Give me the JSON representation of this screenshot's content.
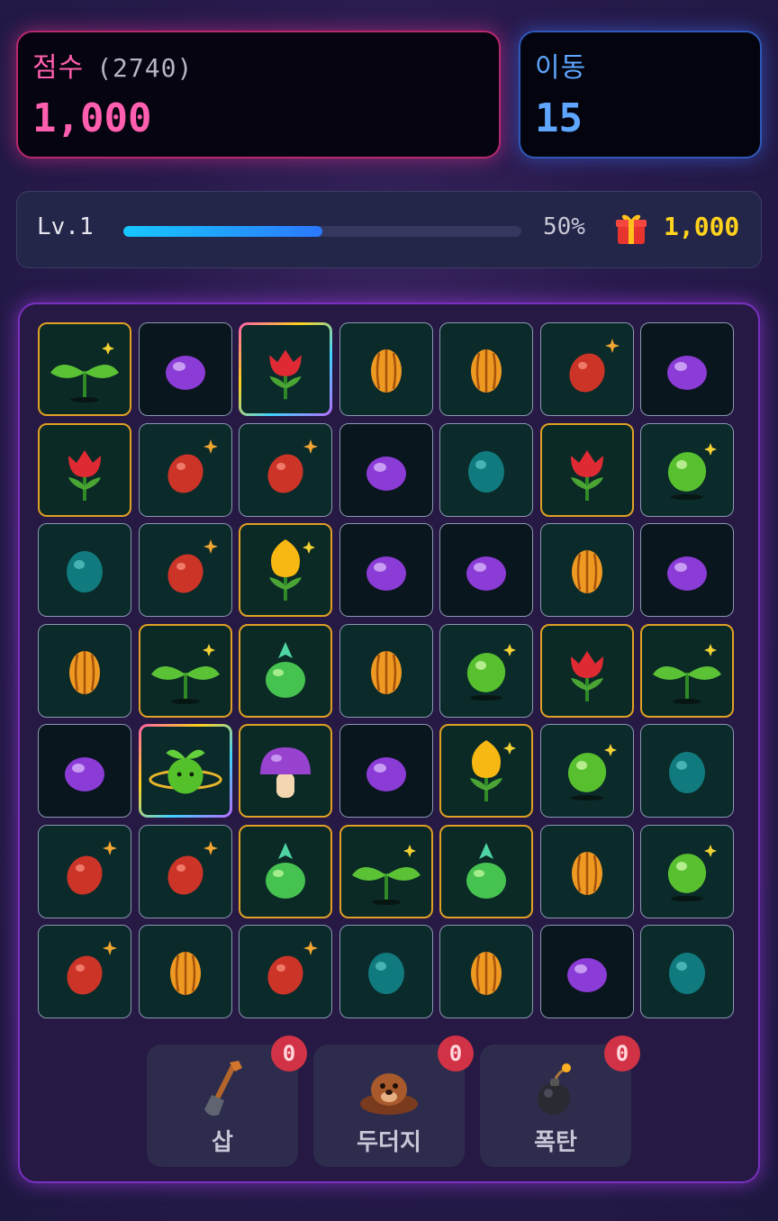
{
  "score": {
    "label": "점수",
    "best": "(2740)",
    "value": "1,000"
  },
  "moves": {
    "label": "이동",
    "value": "15"
  },
  "level": {
    "label": "Lv.1",
    "progress": 0.5,
    "percent_text": "50%",
    "reward": "1,000",
    "reward_icon": "gift-icon"
  },
  "board": {
    "rows": 7,
    "cols": 7,
    "tiles": [
      [
        "sprout",
        "purple",
        "tulip-red",
        "seed",
        "seed",
        "red",
        "purple"
      ],
      [
        "tulip-red",
        "red",
        "red",
        "purple",
        "teal",
        "tulip-red",
        "green"
      ],
      [
        "teal",
        "red",
        "tulip-yellow",
        "purple",
        "purple",
        "seed",
        "purple"
      ],
      [
        "seed",
        "sprout",
        "pineapple",
        "seed",
        "green",
        "tulip-red",
        "sprout"
      ],
      [
        "purple",
        "planet-sprout",
        "mushroom",
        "purple",
        "tulip-yellow",
        "green",
        "teal"
      ],
      [
        "red",
        "red",
        "pineapple",
        "sprout",
        "pineapple",
        "seed",
        "green"
      ],
      [
        "red",
        "seed",
        "red",
        "teal",
        "seed",
        "purple",
        "teal"
      ]
    ],
    "tile_frames": [
      [
        "gold",
        "dark",
        "rainbow",
        "plain",
        "plain",
        "plain",
        "dark"
      ],
      [
        "gold",
        "plain",
        "plain",
        "dark",
        "plain",
        "gold",
        "plain"
      ],
      [
        "plain",
        "plain",
        "gold",
        "dark",
        "dark",
        "plain",
        "dark"
      ],
      [
        "plain",
        "gold",
        "gold",
        "plain",
        "plain",
        "gold",
        "gold"
      ],
      [
        "dark",
        "rainbow",
        "gold",
        "dark",
        "gold",
        "plain",
        "plain"
      ],
      [
        "plain",
        "plain",
        "gold",
        "gold",
        "gold",
        "plain",
        "plain"
      ],
      [
        "plain",
        "plain",
        "plain",
        "plain",
        "plain",
        "dark",
        "plain"
      ]
    ]
  },
  "tools": [
    {
      "name": "삽",
      "count": "0",
      "icon": "shovel-icon"
    },
    {
      "name": "두더지",
      "count": "0",
      "icon": "mole-icon"
    },
    {
      "name": "폭탄",
      "count": "0",
      "icon": "bomb-icon"
    }
  ],
  "colors": {
    "score": "#ff5fae",
    "moves": "#5ea6ff",
    "reward": "#ffd21c",
    "progress": "#17c8ff",
    "badge": "#d23245"
  }
}
